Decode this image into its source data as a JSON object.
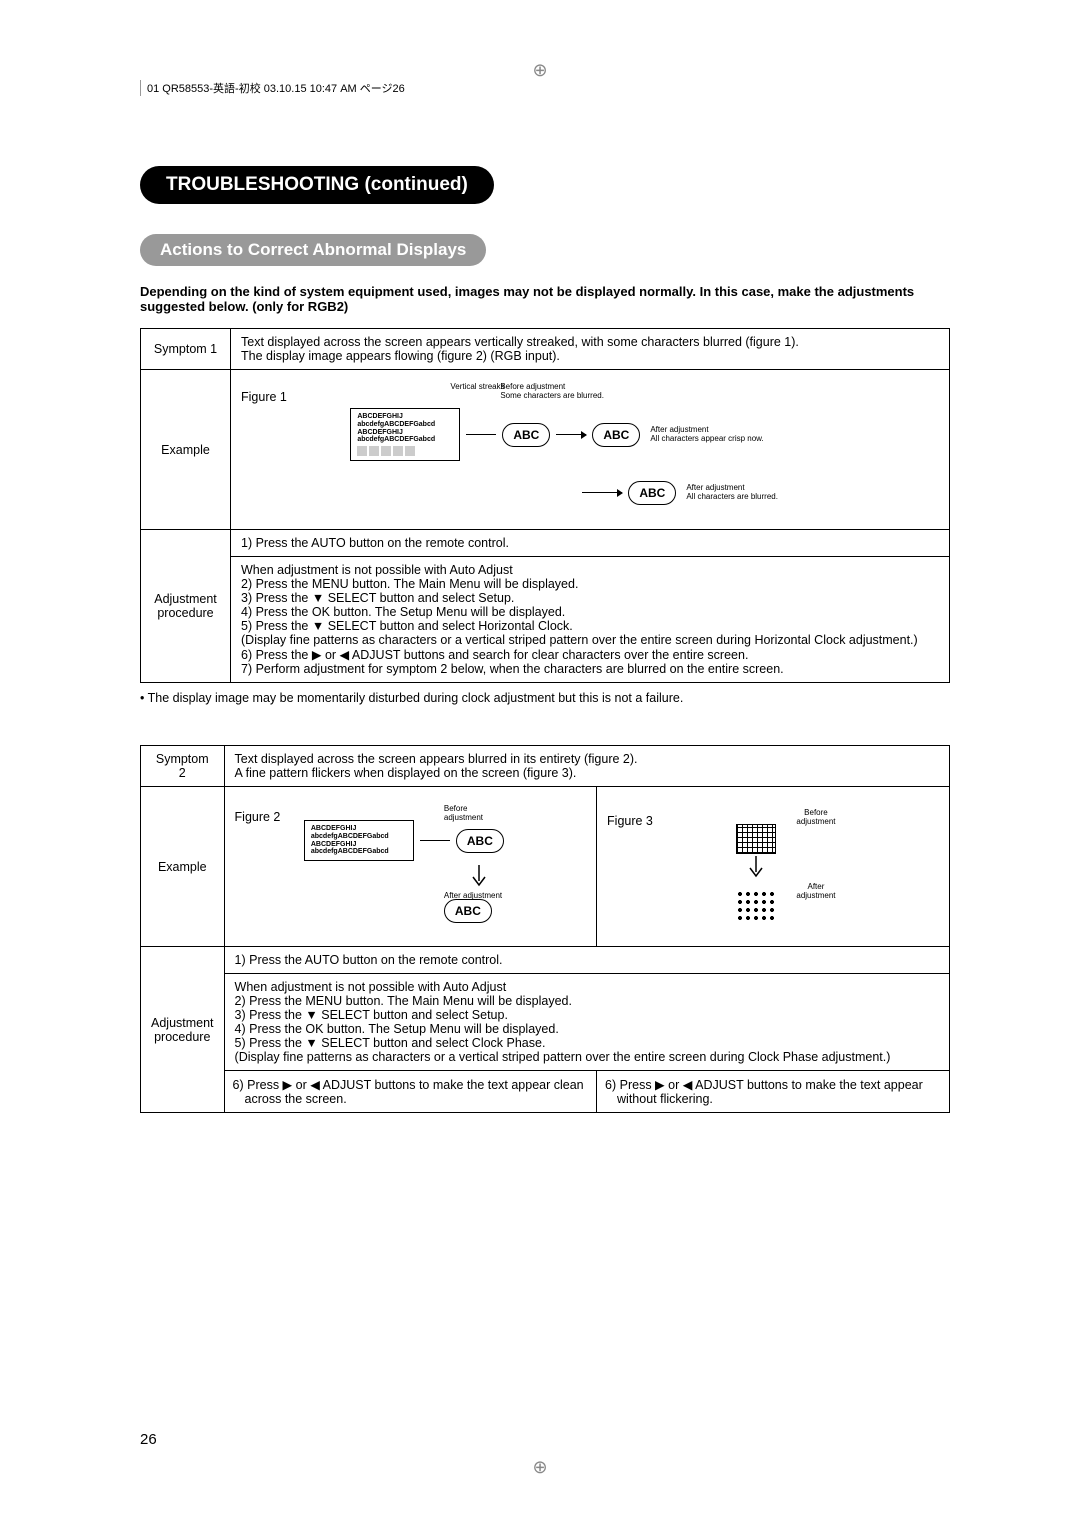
{
  "header": "01 QR58553-英語-初校  03.10.15  10:47 AM  ページ26",
  "title": "TROUBLESHOOTING (continued)",
  "subtitle": "Actions to Correct Abnormal Displays",
  "intro": "Depending on the kind of system equipment used, images may not be displayed normally.  In this case, make the adjustments suggested below. (only for RGB2)",
  "symptom1": {
    "label": "Symptom 1",
    "text": "Text displayed across the screen appears vertically streaked, with some characters blurred (figure 1).\nThe display image appears flowing (figure 2) (RGB input).",
    "example_label": "Example",
    "figure_label": "Figure 1",
    "fig": {
      "vertical_streaks": "Vertical streaks",
      "before": "Before adjustment\nSome characters are blurred.",
      "abc": "ABC",
      "after_crisp": "After adjustment\nAll characters appear crisp now.",
      "after_blur": "After adjustment\nAll characters are blurred.",
      "lines": "ABCDEFGHIJ\nabcdefgABCDEFGabcd\nABCDEFGHIJ\nabcdefgABCDEFGabcd"
    },
    "adj_label": "Adjustment procedure",
    "step1": "1) Press the AUTO button on the remote control.",
    "steps": "When adjustment is not possible with Auto Adjust\n2) Press the MENU button. The Main Menu will be displayed.\n3) Press the ▼ SELECT button and select Setup.\n4) Press the OK button. The Setup Menu will be displayed.\n5) Press the ▼ SELECT button and select Horizontal Clock.\n(Display fine patterns as characters or a vertical striped pattern over the entire screen during Horizontal Clock adjustment.)\n6) Press the ▶ or ◀ ADJUST buttons and search for clear characters over the entire screen.\n7) Perform adjustment for symptom 2 below, when the characters are blurred on the entire screen."
  },
  "note1": "• The display image may be momentarily disturbed during clock adjustment but this is not a failure.",
  "symptom2": {
    "label": "Symptom 2",
    "text": "Text displayed across the screen appears blurred in its entirety (figure 2).\nA fine pattern flickers when displayed on the screen (figure 3).",
    "example_label": "Example",
    "figure2_label": "Figure 2",
    "figure3_label": "Figure 3",
    "fig2": {
      "before": "Before adjustment",
      "after": "After adjustment",
      "abc": "ABC",
      "lines": "ABCDEFGHIJ\nabcdefgABCDEFGabcd\nABCDEFGHIJ\nabcdefgABCDEFGabcd"
    },
    "fig3": {
      "before": "Before adjustment",
      "after": "After adjustment"
    },
    "adj_label": "Adjustment procedure",
    "step1": "1) Press the AUTO button on the remote control.",
    "steps": "When adjustment is not possible with Auto Adjust\n2) Press the MENU button. The Main Menu will be displayed.\n3) Press the ▼ SELECT button and select Setup.\n4) Press the OK button. The Setup Menu will be displayed.\n5) Press the ▼ SELECT button and select Clock Phase.\n(Display fine patterns as characters or a vertical striped pattern over the entire screen during Clock Phase adjustment.)",
    "step6a": "6) Press ▶ or ◀ ADJUST buttons to make the text appear clean across the screen.",
    "step6b": "6) Press ▶ or ◀ ADJUST buttons to make the text appear without flickering."
  },
  "pagenum": "26"
}
